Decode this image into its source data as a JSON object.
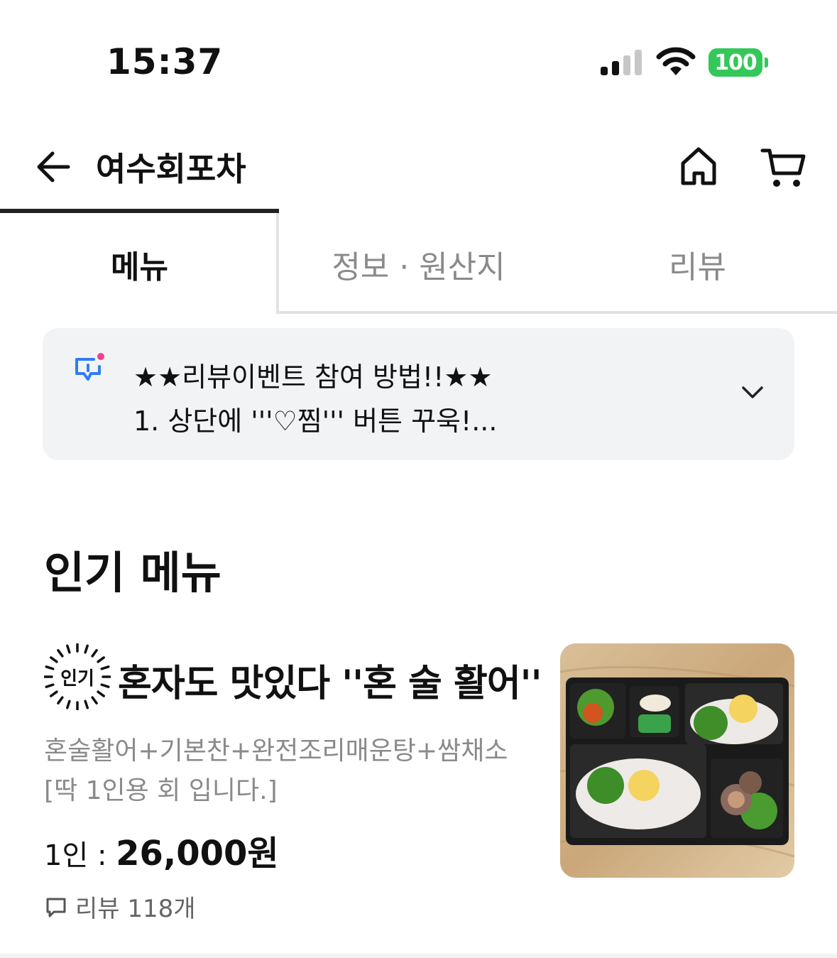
{
  "status_bar": {
    "time": "15:37",
    "battery": "100",
    "icons": [
      "cellular-signal-icon",
      "wifi-icon",
      "battery-icon"
    ],
    "battery_color": "#34c759"
  },
  "header": {
    "title": "여수회포차",
    "icons": [
      "back-arrow-icon",
      "home-icon",
      "cart-icon"
    ]
  },
  "tabs": [
    {
      "label": "메뉴",
      "active": true
    },
    {
      "label": "정보 · 원산지",
      "active": false
    },
    {
      "label": "리뷰",
      "active": false
    }
  ],
  "notice": {
    "line1": "★★리뷰이벤트 참여 방법!!★★",
    "line2": "1. 상단에 '''♡찜''' 버튼 꾸욱!...",
    "icon": "announcement-icon",
    "accent_color": "#2f7cf6",
    "dot_color": "#ef3f8f"
  },
  "section": {
    "title": "인기 메뉴"
  },
  "menu_item": {
    "badge": "인기",
    "name": "혼자도 맛있다 ''혼 술 활어''",
    "description": "혼술활어+기본찬+완전조리매운탕+쌈채소 [딱 1인용 회 입니다.]",
    "price_label": "1인 : ",
    "price": "26,000원",
    "reviews": "리뷰 118개",
    "image": "sashimi-lunchbox-photo"
  }
}
